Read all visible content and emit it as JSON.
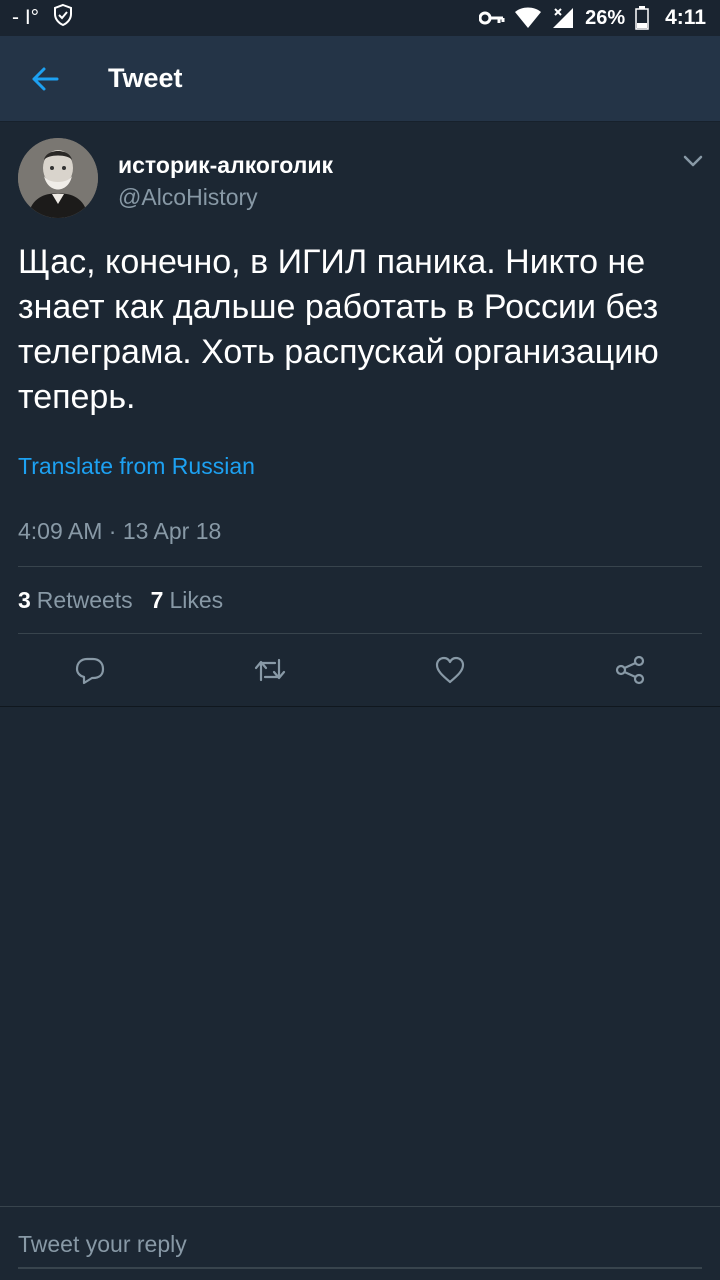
{
  "status_bar": {
    "left_text": "- I°",
    "battery": "26%",
    "time": "4:11",
    "icons": [
      "shield-check-icon",
      "key-icon",
      "wifi-icon",
      "signal-icon",
      "battery-icon"
    ]
  },
  "app_bar": {
    "title": "Tweet",
    "back_icon": "arrow-left-icon"
  },
  "tweet": {
    "author_name": "историк-алкоголик",
    "author_handle": "@AlcoHistory",
    "text": "Щас, конечно, в ИГИЛ паника. Никто не знает как дальше работать в России без телеграма. Хоть распускай организацию теперь.",
    "translate_label": "Translate from Russian",
    "timestamp": "4:09 AM · 13 Apr 18",
    "retweets_count": "3",
    "retweets_label": "Retweets",
    "likes_count": "7",
    "likes_label": "Likes"
  },
  "actions": [
    "reply-icon",
    "retweet-icon",
    "like-icon",
    "share-icon"
  ],
  "reply": {
    "placeholder": "Tweet your reply"
  },
  "colors": {
    "background": "#1c2733",
    "app_bar": "#243447",
    "accent": "#1da1f2",
    "secondary_text": "#8899a6",
    "divider": "#38444d"
  }
}
